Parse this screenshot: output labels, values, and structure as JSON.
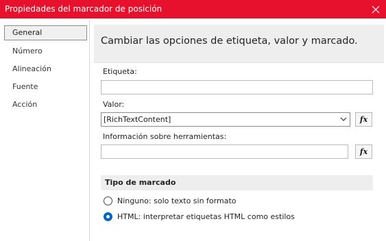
{
  "window": {
    "title": "Propiedades del marcador de posición"
  },
  "nav": {
    "items": [
      {
        "label": "General",
        "selected": true
      },
      {
        "label": "Número",
        "selected": false
      },
      {
        "label": "Alineación",
        "selected": false
      },
      {
        "label": "Fuente",
        "selected": false
      },
      {
        "label": "Acción",
        "selected": false
      }
    ]
  },
  "main": {
    "heading": "Cambiar las opciones de etiqueta, valor y marcado.",
    "label_field": {
      "label": "Etiqueta:",
      "value": ""
    },
    "value_field": {
      "label": "Valor:",
      "value": "[RichTextContent]"
    },
    "tooltip_field": {
      "label": "Información sobre herramientas:",
      "value": ""
    },
    "fx_label": "fx",
    "markup": {
      "title": "Tipo de marcado",
      "options": [
        {
          "label": "Ninguno: solo texto sin formato",
          "checked": false
        },
        {
          "label": "HTML: interpretar etiquetas HTML como estilos",
          "checked": true
        }
      ]
    }
  },
  "colors": {
    "titlebar": "#e8112d",
    "radio_accent": "#0067c0",
    "header_bg": "#eeeeee"
  }
}
